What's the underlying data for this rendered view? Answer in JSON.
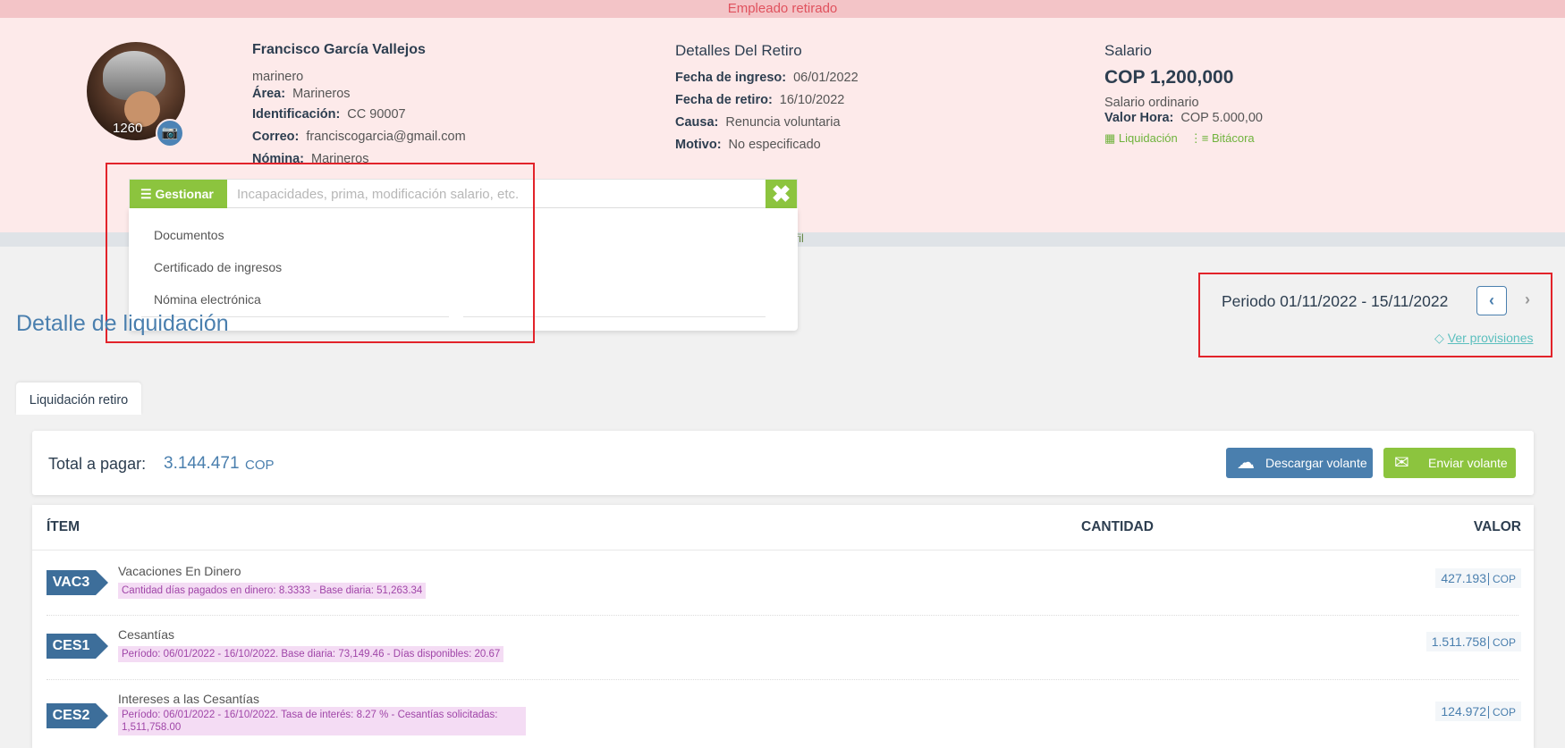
{
  "banner": "Empleado retirado",
  "avatar": {
    "count": "1260"
  },
  "employee": {
    "name": "Francisco García Vallejos",
    "role": "marinero",
    "area_label": "Área:",
    "area": "Marineros",
    "id_label": "Identificación:",
    "id": "CC 90007",
    "email_label": "Correo:",
    "email": "franciscogarcia@gmail.com",
    "nomina_label": "Nómina:",
    "nomina": "Marineros"
  },
  "retiro": {
    "title": "Detalles Del Retiro",
    "ingreso_label": "Fecha de ingreso:",
    "ingreso": "06/01/2022",
    "retiro_label": "Fecha de retiro:",
    "retiro": "16/10/2022",
    "causa_label": "Causa:",
    "causa": "Renuncia voluntaria",
    "motivo_label": "Motivo:",
    "motivo": "No especificado"
  },
  "salario": {
    "title": "Salario",
    "value": "COP 1,200,000",
    "type": "Salario ordinario",
    "hora_label": "Valor Hora:",
    "hora": "COP 5.000,00",
    "liquidacion": "Liquidación",
    "bitacora": "Bitácora"
  },
  "ghost_text": "erfil",
  "gestionar": {
    "button": "Gestionar",
    "placeholder": "Incapacidades, prima, modificación salario, etc.",
    "items": [
      "Documentos",
      "Certificado de ingresos",
      "Nómina electrónica"
    ]
  },
  "detail_title": "Detalle de liquidación",
  "periodo": "Periodo 01/11/2022 - 15/11/2022",
  "ver_provisiones": "Ver provisiones",
  "tab": "Liquidación retiro",
  "total": {
    "label": "Total a pagar:",
    "value": "3.144.471",
    "currency": "COP"
  },
  "buttons": {
    "descargar": "Descargar volante",
    "enviar": "Enviar volante"
  },
  "table": {
    "headers": {
      "item": "ÍTEM",
      "cantidad": "CANTIDAD",
      "valor": "VALOR"
    },
    "rows": [
      {
        "code": "VAC3",
        "name": "Vacaciones En Dinero",
        "detail": "Cantidad días pagados en dinero: 8.3333 - Base diaria: 51,263.34",
        "value": "427.193",
        "currency": "COP"
      },
      {
        "code": "CES1",
        "name": "Cesantías",
        "detail": "Período: 06/01/2022 - 16/10/2022. Base diaria: 73,149.46 - Días disponibles: 20.67",
        "value": "1.511.758",
        "currency": "COP"
      },
      {
        "code": "CES2",
        "name": "Intereses a las Cesantías",
        "detail": "Período: 06/01/2022 - 16/10/2022. Tasa de interés: 8.27 % - Cesantías solicitadas: 1,511,758.00",
        "value": "124.972",
        "currency": "COP"
      }
    ]
  },
  "colors": {
    "accent_blue": "#4a7fae",
    "accent_green": "#8cc43e",
    "retired_pink": "#fdeaea",
    "highlight_red": "#e2232a"
  }
}
